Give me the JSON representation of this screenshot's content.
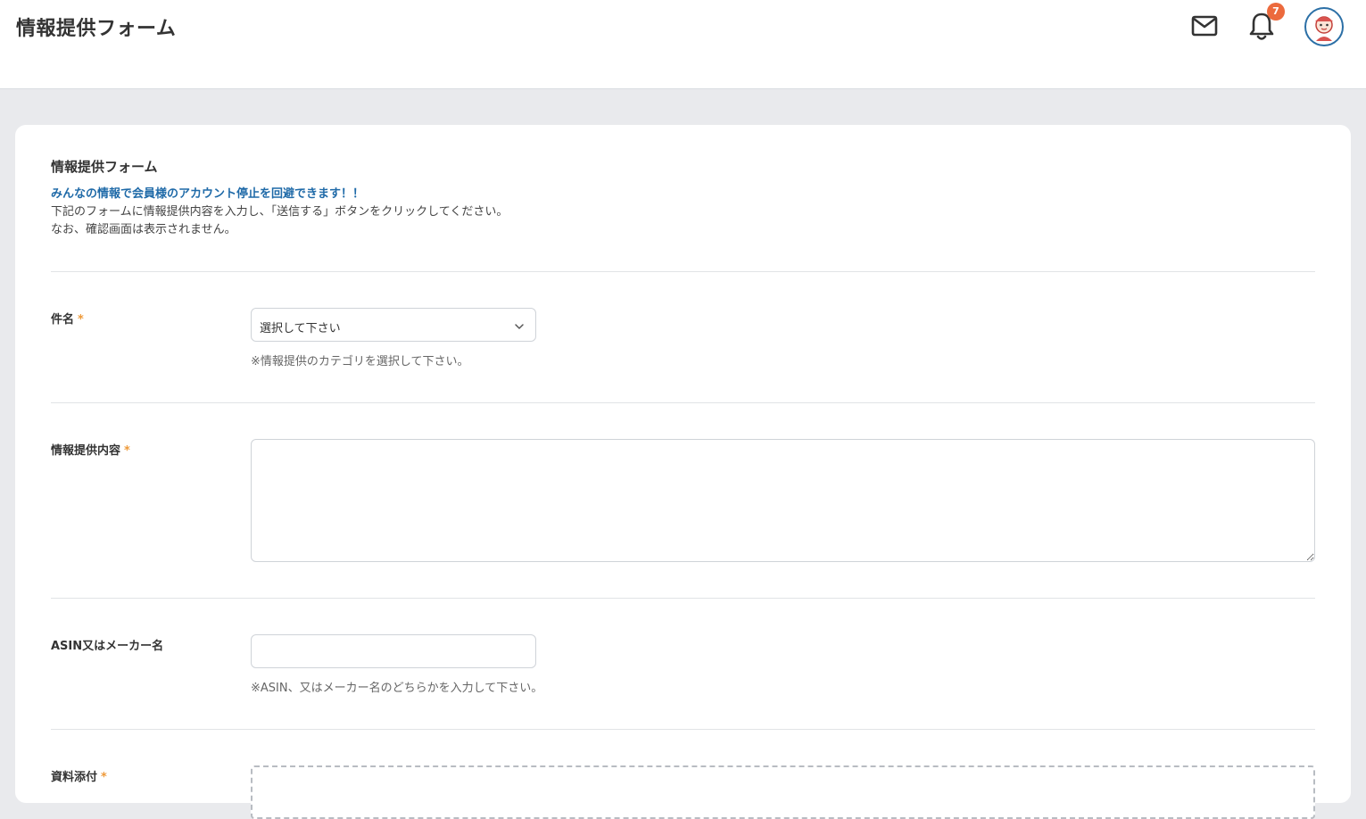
{
  "header": {
    "title": "情報提供フォーム",
    "notification_count": "7",
    "icons": {
      "mail": "mail-icon",
      "bell": "bell-icon",
      "avatar": "user-avatar"
    },
    "badge_color": "#ec6a3d"
  },
  "form": {
    "heading": "情報提供フォーム",
    "highlight": "みんなの情報で会員様のアカウント停止を回避できます！！",
    "instruction": "下記のフォームに情報提供内容を入力し、「送信する」ボタンをクリックしてください。",
    "note": "なお、確認画面は表示されません。",
    "required_mark": "*",
    "fields": {
      "subject": {
        "label": "件名",
        "selected": "選択して下さい",
        "hint": "※情報提供のカテゴリを選択して下さい。"
      },
      "content": {
        "label": "情報提供内容",
        "value": ""
      },
      "asin": {
        "label": "ASIN又はメーカー名",
        "value": "",
        "hint": "※ASIN、又はメーカー名のどちらかを入力して下さい。"
      },
      "attachment": {
        "label": "資料添付"
      }
    }
  },
  "colors": {
    "accent_text": "#1f6aa8",
    "required": "#ee9a3a",
    "page_bg": "#e9eaed"
  }
}
